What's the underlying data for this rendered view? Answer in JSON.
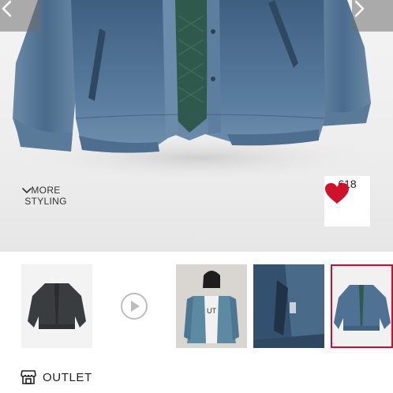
{
  "hero": {
    "image_alt": "denim-jacket-photo",
    "prev_icon": "chevron-left-icon",
    "next_icon": "chevron-right-icon"
  },
  "more_styling": {
    "line1": "MORE",
    "line2": "STYLING",
    "icon": "chevron-down-icon"
  },
  "likes": {
    "icon": "heart-icon",
    "count": "618",
    "color": "#d0112b"
  },
  "thumbnails": [
    {
      "name": "thumb-black-jacket",
      "selected": false
    },
    {
      "name": "thumb-video",
      "icon": "play-icon",
      "selected": false
    },
    {
      "name": "thumb-model-wearing",
      "selected": false
    },
    {
      "name": "thumb-detail-closeup",
      "selected": false
    },
    {
      "name": "thumb-denim-jacket",
      "selected": true
    }
  ],
  "outlet": {
    "icon": "store-icon",
    "label": "OUTLET"
  },
  "colors": {
    "accent": "#c8102e",
    "denim": "#4f7193"
  }
}
